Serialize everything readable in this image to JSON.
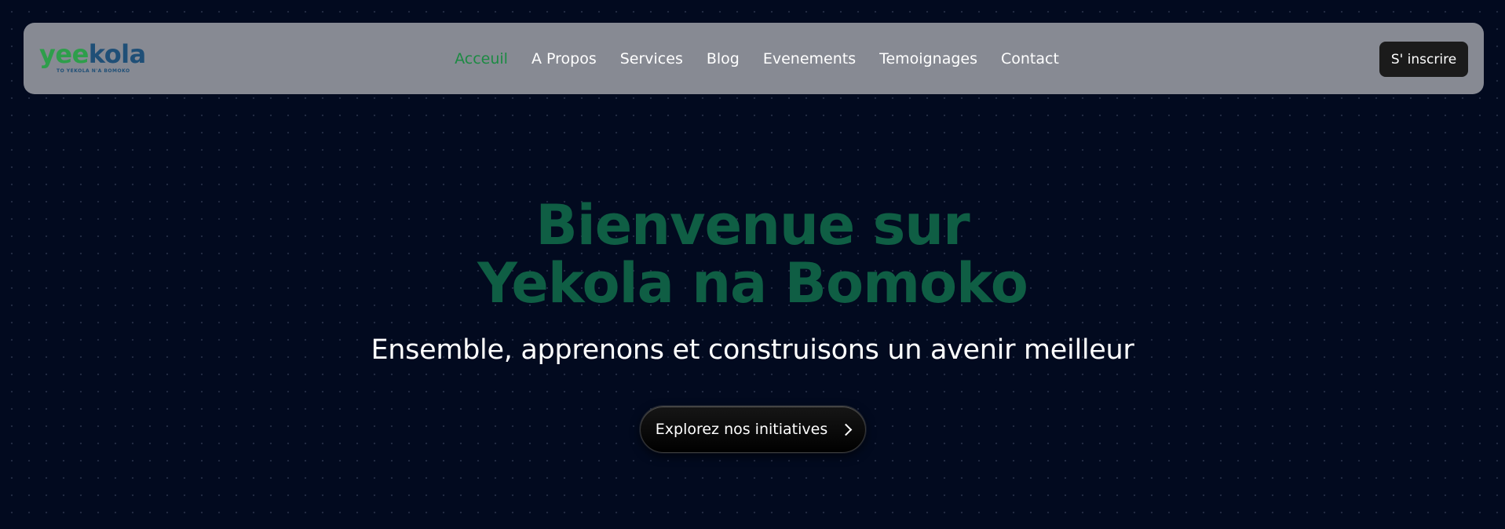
{
  "header": {
    "logo": {
      "word_part1": "yee",
      "word_part2": "k",
      "word_part3": "o",
      "word_part4": "la",
      "tagline": "TO YEKOLA N'A BOMOKO"
    },
    "nav": [
      {
        "label": "Acceuil",
        "active": true
      },
      {
        "label": "A Propos",
        "active": false
      },
      {
        "label": "Services",
        "active": false
      },
      {
        "label": "Blog",
        "active": false
      },
      {
        "label": "Evenements",
        "active": false
      },
      {
        "label": "Temoignages",
        "active": false
      },
      {
        "label": "Contact",
        "active": false
      }
    ],
    "signup_label": "S' inscrire"
  },
  "hero": {
    "title_line1": "Bienvenue sur",
    "title_line2": "Yekola na Bomoko",
    "subtitle": "Ensemble, apprenons et construisons un avenir meilleur",
    "cta_label": "Explorez nos initiatives",
    "cta_icon": "chevron-right-icon"
  },
  "colors": {
    "background": "#020a1f",
    "navbar": "#878a93",
    "nav_active": "#1c8a43",
    "title": "#0f5e44",
    "logo_green": "#2e9e4b",
    "logo_blue": "#1f4f77",
    "signup_button": "#1b1b1b"
  }
}
